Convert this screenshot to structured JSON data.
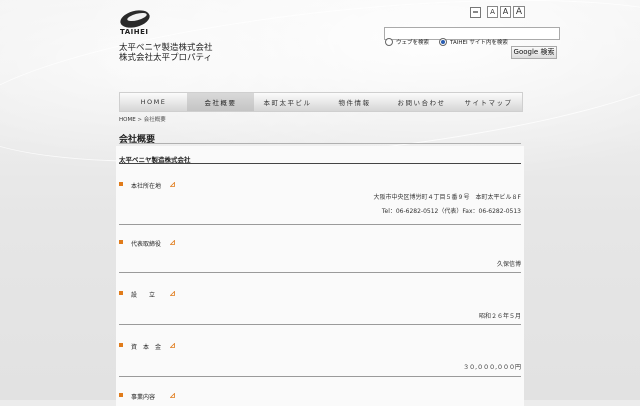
{
  "brand": {
    "logo_text": "TAIHEI",
    "company_line1": "太平ベニヤ製造株式会社",
    "company_line2": "株式会社太平プロパティ"
  },
  "font_size": {
    "small": "A",
    "medium": "A",
    "large": "A"
  },
  "search": {
    "placeholder": "",
    "option_web": "ウェブを検索",
    "option_site": "TAIHEI サイト内を検索",
    "selected": "site",
    "button_label": "Google 検索"
  },
  "nav": {
    "items": [
      {
        "label": "HOME"
      },
      {
        "label": "会社概要"
      },
      {
        "label": "本町太平ビル"
      },
      {
        "label": "物件情報"
      },
      {
        "label": "お問い合わせ"
      },
      {
        "label": "サイトマップ"
      }
    ],
    "active_index": 1
  },
  "breadcrumb": {
    "home": "HOME",
    "separator": " > ",
    "current": "会社概要"
  },
  "page_title": "会社概要",
  "company_name": "太平ベニヤ製造株式会社",
  "items": [
    {
      "label": "本社所在地",
      "lines": [
        "大阪市中央区博労町４丁目５番９号　本町太平ビル８F",
        "Tel：06-6282-0512（代表）Fax：06-6282-0513"
      ]
    },
    {
      "label": "代表取締役",
      "lines": [
        "久保信博"
      ]
    },
    {
      "label": "設　　立",
      "lines": [
        "昭和２６年５月"
      ]
    },
    {
      "label": "資　本　金",
      "lines": [
        "３０,０００,０００円"
      ]
    },
    {
      "label": "事業内容",
      "lines": []
    }
  ],
  "colors": {
    "accent_bullet": "#e07b1a",
    "nav_bg": "#e6e6e6",
    "page_bg": "#ececec"
  },
  "icons": {
    "print": "printer-icon",
    "label_arrow": "corner-arrow-icon"
  }
}
